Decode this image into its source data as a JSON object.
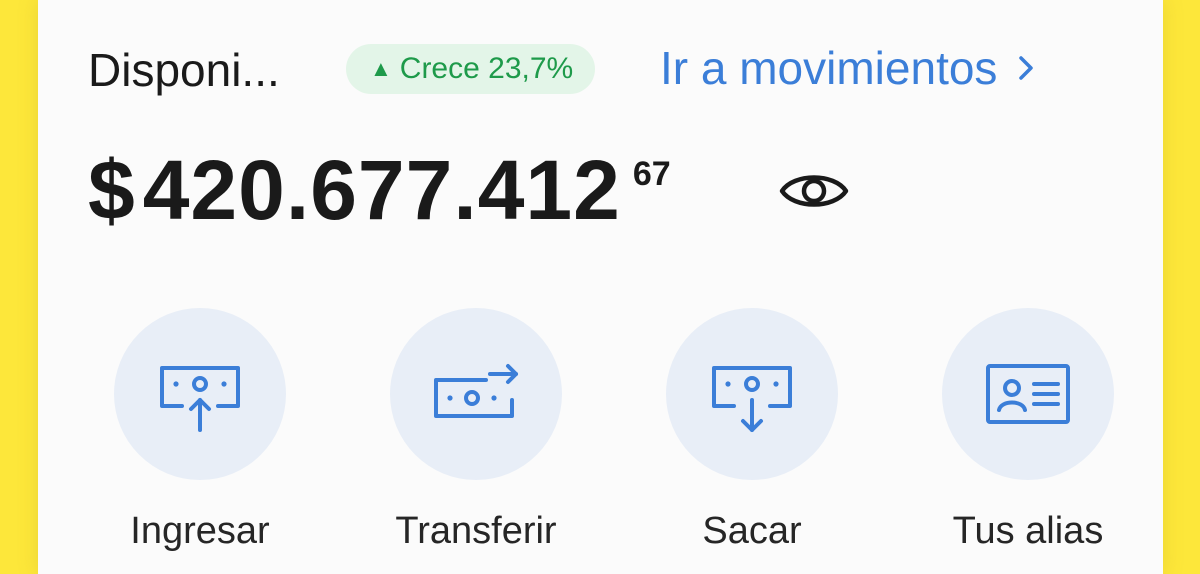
{
  "balance_card": {
    "available_label": "Disponi...",
    "growth_badge": {
      "arrow": "▲",
      "text": "Crece 23,7%",
      "color": "#1e9a4a",
      "background": "#e3f5e8"
    },
    "movements_link": {
      "label": "Ir a movimientos",
      "icon": "chevron-right-icon",
      "color": "#3b7ed8"
    },
    "balance": {
      "currency": "$",
      "amount": "420.677.412",
      "cents": "67"
    },
    "visibility_toggle_icon": "eye-icon"
  },
  "actions": [
    {
      "label": "Ingresar",
      "icon": "cash-deposit-icon"
    },
    {
      "label": "Transferir",
      "icon": "cash-transfer-icon"
    },
    {
      "label": "Sacar",
      "icon": "cash-withdraw-icon"
    },
    {
      "label": "Tus alias",
      "icon": "id-card-icon"
    }
  ],
  "colors": {
    "background_yellow": "#fde73a",
    "card": "#fbfbfb",
    "icon_blue": "#3b7ed8",
    "action_circle": "#e8eef7"
  }
}
